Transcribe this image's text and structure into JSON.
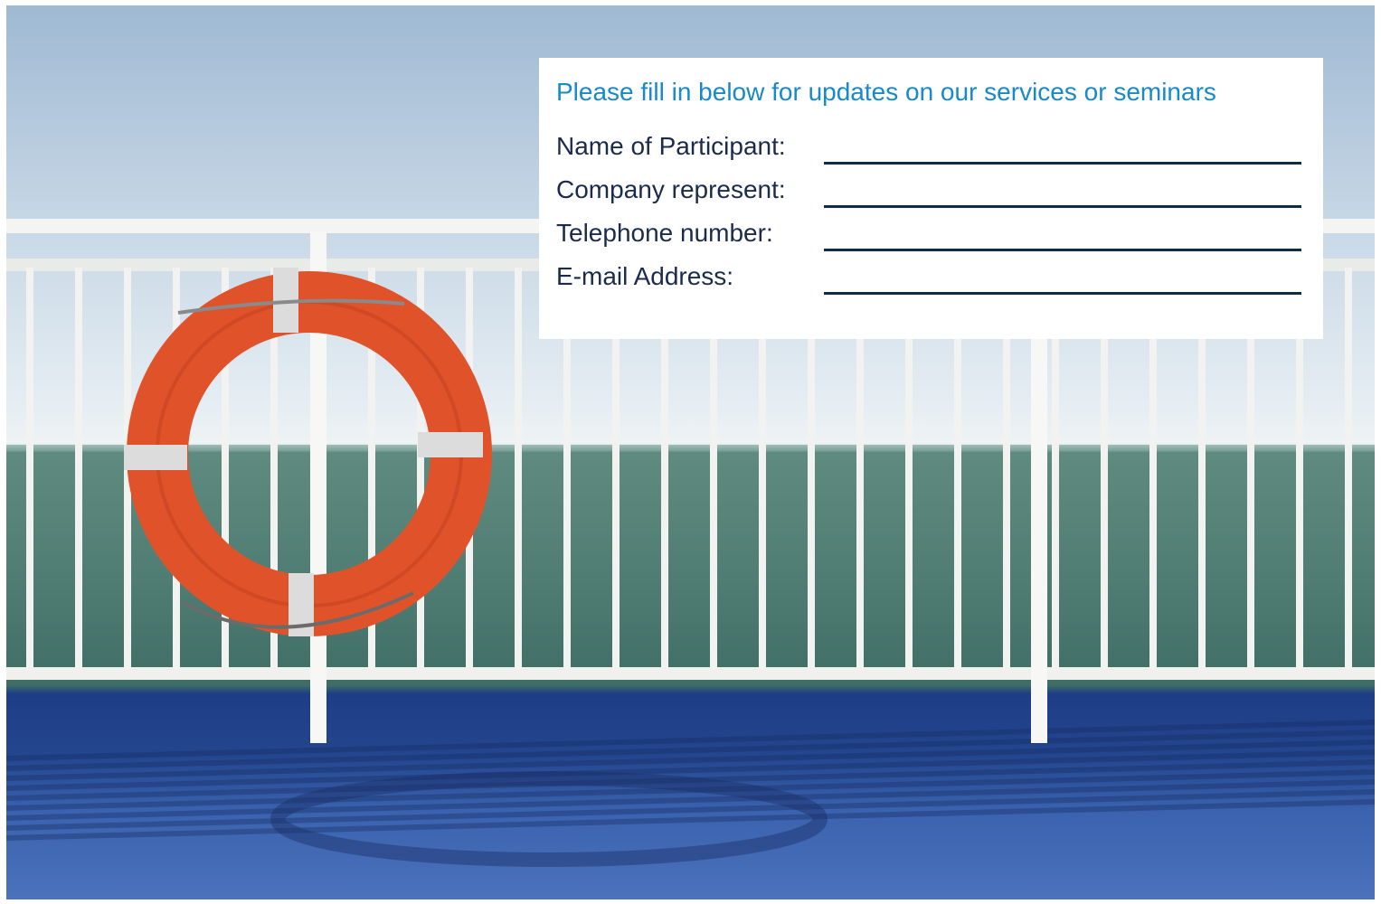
{
  "form": {
    "heading": "Please fill in below for updates on our services or seminars",
    "fields": [
      {
        "label": "Name of Participant:",
        "value": ""
      },
      {
        "label": "Company represent:",
        "value": ""
      },
      {
        "label": "Telephone number:",
        "value": ""
      },
      {
        "label": "E-mail Address:",
        "value": ""
      }
    ]
  },
  "colors": {
    "heading": "#1889c9",
    "label": "#1b2b4b",
    "line": "#102a4c",
    "lifebuoy": "#e0532a",
    "deck": "#2a4f9c",
    "sea": "#4f7c72"
  },
  "photo": {
    "subject": "lifebuoy on ship railing at sea"
  }
}
